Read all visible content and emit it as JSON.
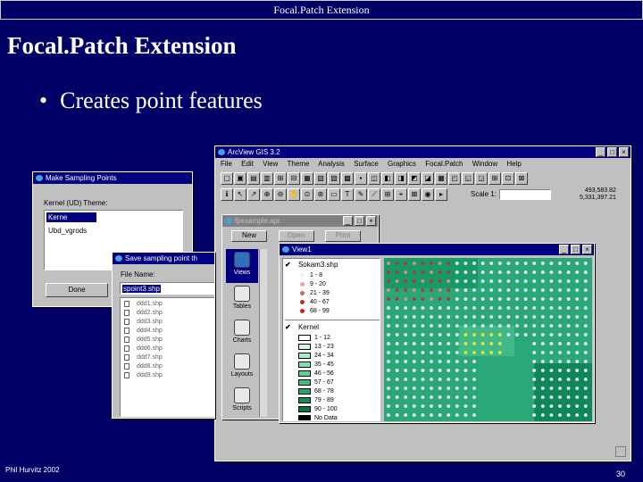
{
  "header": {
    "title": "Focal.Patch Extension"
  },
  "slide": {
    "title": "Focal.Patch Extension",
    "bullet": "Creates point features"
  },
  "footer": {
    "author": "Phil Hurvitz 2002",
    "page": "30"
  },
  "arcview": {
    "title": "ArcView GIS 3.2",
    "menus": [
      "File",
      "Edit",
      "View",
      "Theme",
      "Analysis",
      "Surface",
      "Graphics",
      "Focal.Patch",
      "Window",
      "Help"
    ],
    "scale_label": "Scale 1:",
    "coords": [
      "493,583.82",
      "5,331,397.21"
    ]
  },
  "project": {
    "title": "fpexample.apr",
    "buttons": [
      "New",
      "Open",
      "Print"
    ],
    "icons": [
      "Views",
      "Tables",
      "Charts",
      "Layouts",
      "Scripts"
    ]
  },
  "view": {
    "title": "View1",
    "theme1": {
      "name": "Sokam3.shp",
      "classes": [
        {
          "label": "1 - 8",
          "color": "#f0f0f0"
        },
        {
          "label": "9 - 20",
          "color": "#e0a8a8"
        },
        {
          "label": "21 - 39",
          "color": "#cc6666"
        },
        {
          "label": "40 - 67",
          "color": "#b03030"
        },
        {
          "label": "68 - 99",
          "color": "#cc2020"
        }
      ]
    },
    "theme2": {
      "name": "Kernel",
      "classes": [
        {
          "label": "1 - 12",
          "color": "#f8fff8"
        },
        {
          "label": "13 - 23",
          "color": "#d0f5e0"
        },
        {
          "label": "24 - 34",
          "color": "#a8ecc8"
        },
        {
          "label": "35 - 45",
          "color": "#80e0b0"
        },
        {
          "label": "46 - 56",
          "color": "#60d098"
        },
        {
          "label": "57 - 67",
          "color": "#40c080"
        },
        {
          "label": "68 - 78",
          "color": "#20a868"
        },
        {
          "label": "79 - 89",
          "color": "#109050"
        },
        {
          "label": "90 - 100",
          "color": "#007840"
        },
        {
          "label": "No Data",
          "color": "#000000"
        }
      ]
    }
  },
  "sampling": {
    "title": "Make Sampling Points",
    "label": "Kernel (UD) Theme:",
    "options": [
      "Kerne",
      "Ubd_vgrods"
    ],
    "button": "Done"
  },
  "save": {
    "title": "Save sampling point th",
    "label": "File Name:",
    "filename": "spoint3.shp",
    "files": [
      "ddd1.shp",
      "ddd2.shp",
      "ddd3.shp",
      "ddd4.shp",
      "ddd5.shp",
      "ddd6.shp",
      "ddd7.shp",
      "ddd8.shp",
      "ddd9.shp"
    ]
  },
  "colors": {
    "background": "#000066",
    "titlebar": "#000080",
    "map_green": "#2aa878"
  }
}
